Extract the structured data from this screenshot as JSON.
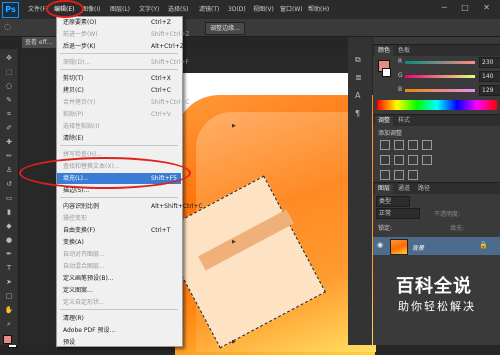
{
  "app": {
    "logo": "Ps"
  },
  "menubar": {
    "items": [
      "文件(F)",
      "编辑(E)",
      "图像(I)",
      "图层(L)",
      "文字(Y)",
      "选择(S)",
      "滤镜(T)",
      "3D(D)",
      "视图(V)",
      "窗口(W)",
      "帮助(H)"
    ],
    "window_controls": "─ □ ✕"
  },
  "options_bar": {
    "adjust_edge": "调整边缘..."
  },
  "document_tab": {
    "label": "查看 eff..."
  },
  "edit_menu": {
    "items": [
      {
        "label": "还原要素(O)",
        "shortcut": "Ctrl+Z",
        "disabled": false
      },
      {
        "label": "前进一步(W)",
        "shortcut": "Shift+Ctrl+Z",
        "disabled": true
      },
      {
        "label": "后退一步(K)",
        "shortcut": "Alt+Ctrl+Z",
        "disabled": false
      },
      {
        "label": "渐隐(D)...",
        "shortcut": "Shift+Ctrl+F",
        "disabled": true
      },
      {
        "label": "剪切(T)",
        "shortcut": "Ctrl+X",
        "disabled": false
      },
      {
        "label": "拷贝(C)",
        "shortcut": "Ctrl+C",
        "disabled": false
      },
      {
        "label": "合并拷贝(Y)",
        "shortcut": "Shift+Ctrl+C",
        "disabled": true
      },
      {
        "label": "粘贴(P)",
        "shortcut": "Ctrl+V",
        "disabled": true
      },
      {
        "label": "选择性粘贴(I)",
        "shortcut": "",
        "disabled": true
      },
      {
        "label": "清除(E)",
        "shortcut": "",
        "disabled": false
      },
      {
        "label": "拼写检查(H)...",
        "shortcut": "",
        "disabled": true
      },
      {
        "label": "查找和替换文本(X)...",
        "shortcut": "",
        "disabled": true
      },
      {
        "label": "填充(L)...",
        "shortcut": "Shift+F5",
        "disabled": false
      },
      {
        "label": "描边(S)...",
        "shortcut": "",
        "disabled": false
      },
      {
        "label": "内容识别比例",
        "shortcut": "Alt+Shift+Ctrl+C",
        "disabled": false
      },
      {
        "label": "操控变形",
        "shortcut": "",
        "disabled": true
      },
      {
        "label": "自由变换(F)",
        "shortcut": "Ctrl+T",
        "disabled": false
      },
      {
        "label": "变换(A)",
        "shortcut": "",
        "disabled": false
      },
      {
        "label": "自动对齐图层...",
        "shortcut": "",
        "disabled": true
      },
      {
        "label": "自动混合图层...",
        "shortcut": "",
        "disabled": true
      },
      {
        "label": "定义画笔预设(B)...",
        "shortcut": "",
        "disabled": false
      },
      {
        "label": "定义图案...",
        "shortcut": "",
        "disabled": false
      },
      {
        "label": "定义自定形状...",
        "shortcut": "",
        "disabled": true
      },
      {
        "label": "清理(R)",
        "shortcut": "",
        "disabled": false
      },
      {
        "label": "Adobe PDF 预设...",
        "shortcut": "",
        "disabled": false
      },
      {
        "label": "预设",
        "shortcut": "",
        "disabled": false
      },
      {
        "label": "远程连接...",
        "shortcut": "",
        "disabled": false
      }
    ]
  },
  "color_panel": {
    "tabs": [
      "颜色",
      "色板"
    ],
    "r_label": "R",
    "g_label": "G",
    "b_label": "B",
    "r_value": "230",
    "g_value": "140",
    "b_value": "129",
    "foreground": "#e68c81"
  },
  "adjust_panel": {
    "tabs": [
      "调整",
      "样式"
    ],
    "title": "添加调整"
  },
  "layers_panel": {
    "tabs": [
      "图层",
      "通道",
      "路径"
    ],
    "kind": "类型",
    "blend": "正常",
    "opacity_label": "不透明度:",
    "lock_label": "锁定:",
    "fill_label": "填充:",
    "layer_name": "背景"
  },
  "watermark": {
    "title": "百科全说",
    "subtitle": "助你轻松解决"
  }
}
